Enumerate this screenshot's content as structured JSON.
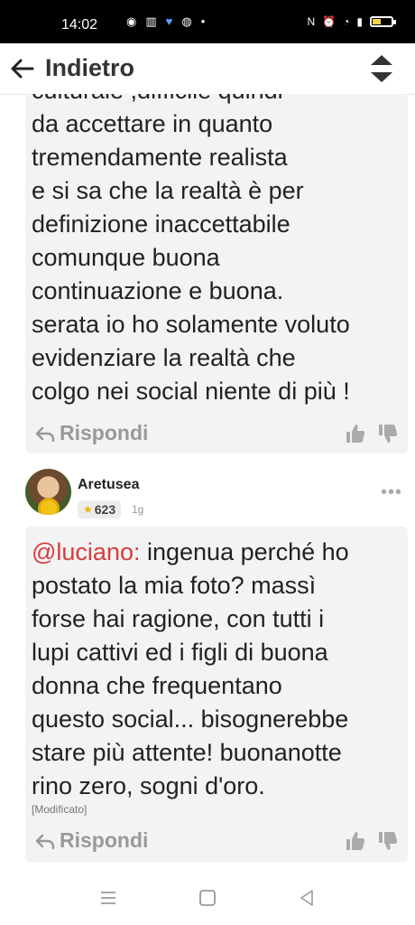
{
  "status_bar": {
    "time": "14:02",
    "left_icons": [
      "whatsapp-icon",
      "trash-icon",
      "heart-icon",
      "chrome-icon",
      "dot-icon"
    ],
    "right_icons": [
      "nfc-icon",
      "alarm-icon",
      "wifi-icon",
      "signal-icon",
      "battery-icon"
    ]
  },
  "header": {
    "back_label": "Indietro",
    "sort_icon": "sort-updown-icon"
  },
  "comments": [
    {
      "text_lines": [
        "culturale ,difficile quindi",
        "da accettare in quanto",
        "tremendamente realista",
        "e si sa che la realtà è per",
        "definizione inaccettabile",
        "comunque buona",
        "continuazione e buona.",
        "serata io ho solamente voluto",
        "evidenziare la realtà che",
        "colgo nei social niente di più !"
      ],
      "reply_label": "Rispondi"
    },
    {
      "author": "Aretusea",
      "score": "623",
      "age": "1g",
      "more": "•••",
      "mention": "@luciano:",
      "text_lines": [
        " ingenua perché ho",
        "postato la mia foto? massì",
        "forse hai ragione, con tutti i",
        "lupi cattivi ed i figli di buona",
        "donna che frequentano",
        "questo social... bisognerebbe",
        "stare più attente! buonanotte",
        "rino zero, sogni d'oro."
      ],
      "modified": "[Modificato]",
      "reply_label": "Rispondi"
    }
  ],
  "nav": [
    "menu-icon",
    "home-square-icon",
    "back-triangle-icon"
  ],
  "colors": {
    "mention": "#d93a3a",
    "card_bg": "#f3f3f3",
    "action_gray": "#999999"
  }
}
